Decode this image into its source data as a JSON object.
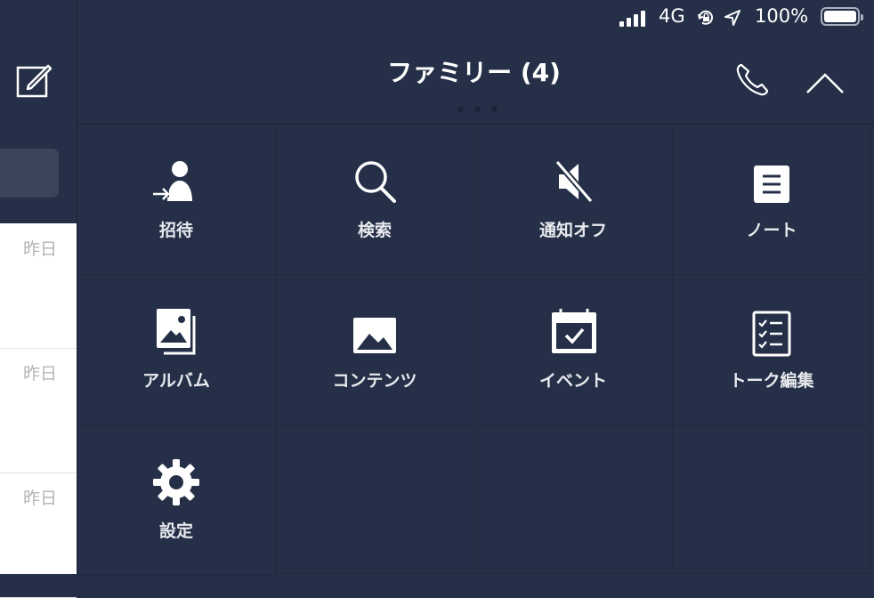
{
  "status_bar": {
    "network": "4G",
    "battery_pct": "100%"
  },
  "header": {
    "title": "ファミリー (4)"
  },
  "chat_list": {
    "dates": [
      "昨日",
      "昨日",
      "昨日"
    ]
  },
  "menu": {
    "items": [
      {
        "label": "招待",
        "icon": "invite-icon"
      },
      {
        "label": "検索",
        "icon": "search-icon"
      },
      {
        "label": "通知オフ",
        "icon": "mute-icon"
      },
      {
        "label": "ノート",
        "icon": "note-icon"
      },
      {
        "label": "アルバム",
        "icon": "album-icon"
      },
      {
        "label": "コンテンツ",
        "icon": "contents-icon"
      },
      {
        "label": "イベント",
        "icon": "event-icon"
      },
      {
        "label": "トーク編集",
        "icon": "edit-talk-icon"
      },
      {
        "label": "設定",
        "icon": "settings-icon"
      }
    ]
  },
  "colors": {
    "background": "#253048",
    "list_bg": "#ffffff",
    "divider": "#1b2436"
  }
}
